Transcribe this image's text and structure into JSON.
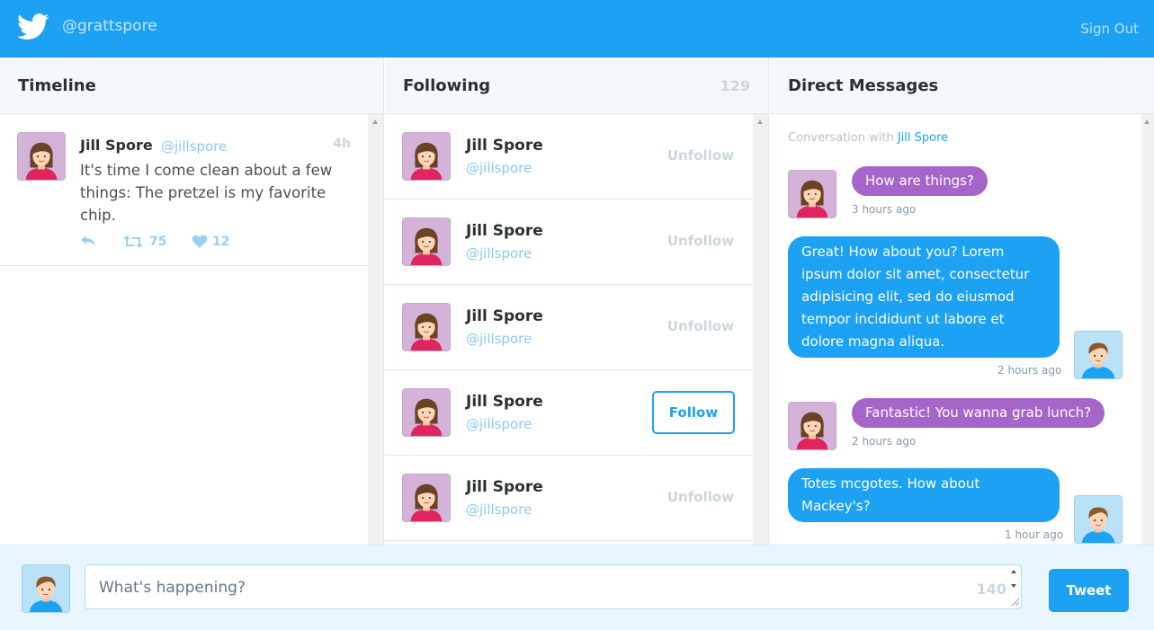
{
  "header": {
    "handle": "@grattspore",
    "sign_out": "Sign Out",
    "logo_icon": "twitter-bird-icon"
  },
  "colors": {
    "brand": "#1da1f2",
    "dm_incoming": "#a665c9",
    "dm_outgoing": "#1da1f2"
  },
  "timeline": {
    "title": "Timeline",
    "tweets": [
      {
        "name": "Jill Spore",
        "handle": "@jillspore",
        "time": "4h",
        "text": "It's time I come clean about a few things: The pretzel is my favorite chip.",
        "retweets": "75",
        "likes": "12"
      }
    ]
  },
  "following": {
    "title": "Following",
    "count": "129",
    "users": [
      {
        "name": "Jill Spore",
        "handle": "@jillspore",
        "action": "Unfollow"
      },
      {
        "name": "Jill Spore",
        "handle": "@jillspore",
        "action": "Unfollow"
      },
      {
        "name": "Jill Spore",
        "handle": "@jillspore",
        "action": "Unfollow"
      },
      {
        "name": "Jill Spore",
        "handle": "@jillspore",
        "action": "Follow"
      },
      {
        "name": "Jill Spore",
        "handle": "@jillspore",
        "action": "Unfollow"
      }
    ]
  },
  "dm": {
    "title": "Direct Messages",
    "conversation_prefix": "Conversation with",
    "conversation_with": "Jill Spore",
    "messages": [
      {
        "from": "them",
        "text": "How are things?",
        "time": "3 hours ago"
      },
      {
        "from": "me",
        "text": "Great! How about you? Lorem ipsum dolor sit amet, consectetur adipisicing elit, sed do eiusmod tempor incididunt ut labore et dolore magna aliqua.",
        "time": "2 hours ago"
      },
      {
        "from": "them",
        "text": "Fantastic! You wanna grab lunch?",
        "time": "2 hours ago"
      },
      {
        "from": "me",
        "text": "Totes mcgotes. How about Mackey's?",
        "time": "1 hour ago"
      }
    ]
  },
  "compose": {
    "placeholder": "What's happening?",
    "char_count": "140",
    "tweet_button": "Tweet"
  }
}
